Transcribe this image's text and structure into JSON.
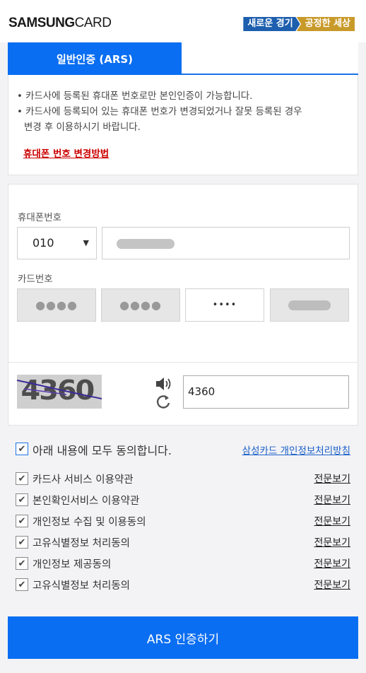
{
  "header": {
    "logo_bold": "SAMSUNG",
    "logo_light": "CARD",
    "slogan_part1": "새로운 경기",
    "slogan_part2": "공정한 세상"
  },
  "tabs": [
    {
      "label": "일반인증 (ARS)",
      "active": true
    }
  ],
  "notice": {
    "line1": "• 카드사에 등록된 휴대폰 번호로만 본인인증이 가능합니다.",
    "line2": "• 카드사에 등록되어 있는 휴대폰 번호가 변경되었거나 잘못 등록된 경우",
    "line3": "변경 후 이용하시기 바랍니다.",
    "link": "휴대폰 번호 변경방법"
  },
  "form": {
    "phone_label": "휴대폰번호",
    "phone_prefix": "010",
    "card_label": "카드번호",
    "card_segments": [
      "●●●●",
      "●●●●",
      "••••",
      ""
    ],
    "captcha_text": "4360",
    "captcha_input": "4360"
  },
  "agreements": {
    "all_label": "아래 내용에 모두 동의합니다.",
    "policy_link": "삼성카드 개인정보처리방침",
    "view_label": "전문보기",
    "items": [
      "카드사 서비스 이용약관",
      "본인확인서비스 이용약관",
      "개인정보 수집 및 이용동의",
      "고유식별정보 처리동의",
      "개인정보 제공동의",
      "고유식별정보 처리동의"
    ]
  },
  "submit_label": "ARS 인증하기",
  "colors": {
    "primary": "#0a6ef2",
    "link_red": "#cc0000",
    "link_blue": "#1a5fc8"
  }
}
